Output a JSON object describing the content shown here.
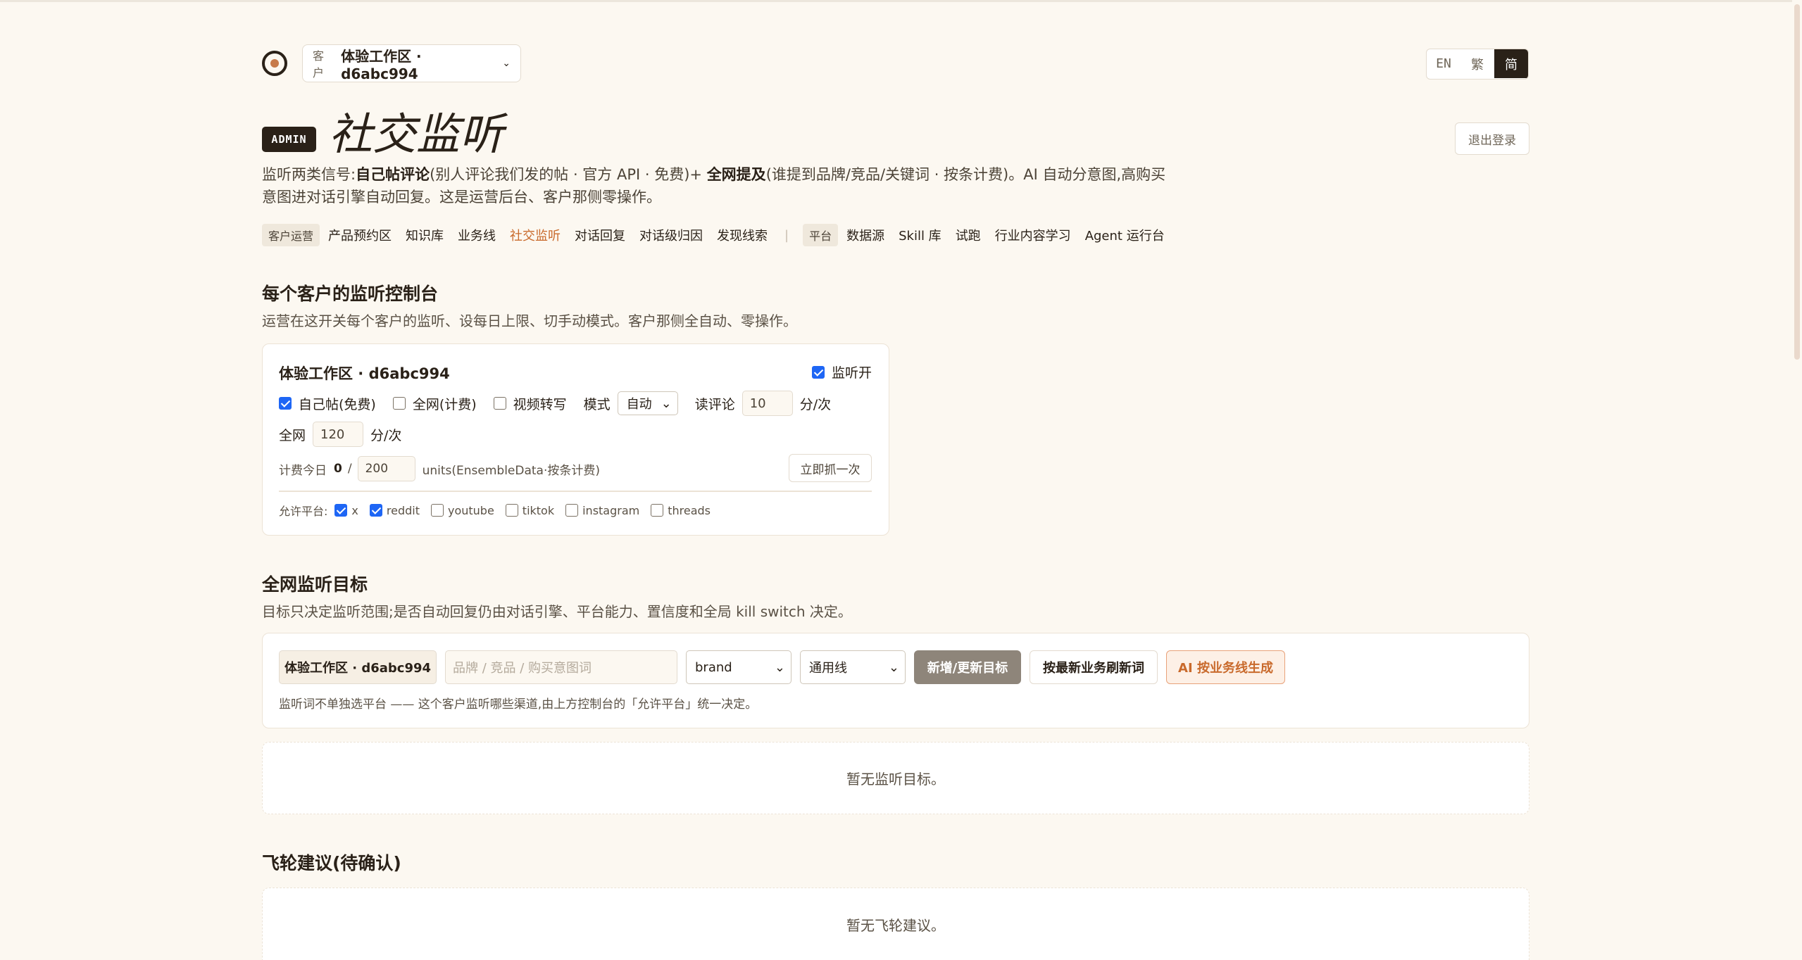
{
  "header": {
    "workspace_prefix": "客户",
    "workspace_name": "体验工作区 · d6abc994",
    "lang": [
      "EN",
      "繁",
      "简"
    ],
    "lang_active": "简",
    "admin_badge": "ADMIN",
    "title": "社交监听",
    "logout": "退出登录"
  },
  "description": {
    "p1": "监听两类信号:",
    "b1": "自己帖评论",
    "p2": "(别人评论我们发的帖 · 官方 API · 免费)+ ",
    "b2": "全网提及",
    "p3": "(谁提到品牌/竞品/关键词 · 按条计费)。AI 自动分意图,高购买意图进对话引擎自动回复。这是运营后台、客户那侧零操作。"
  },
  "nav": {
    "group1_label": "客户运营",
    "group1_items": [
      "产品预约区",
      "知识库",
      "业务线",
      "社交监听",
      "对话回复",
      "对话级归因",
      "发现线索"
    ],
    "active": "社交监听",
    "separator": "|",
    "group2_label": "平台",
    "group2_items": [
      "数据源",
      "Skill 库",
      "试跑",
      "行业内容学习",
      "Agent 运行台"
    ]
  },
  "console": {
    "title": "每个客户的监听控制台",
    "desc": "运营在这开关每个客户的监听、设每日上限、切手动模式。客户那侧全自动、零操作。",
    "card": {
      "name": "体验工作区 · d6abc994",
      "listen_on_label": "监听开",
      "listen_on": true,
      "own_posts_label": "自己帖(免费)",
      "own_posts": true,
      "web_label": "全网(计费)",
      "web": false,
      "video_label": "视频转写",
      "video": false,
      "mode_label": "模式",
      "mode_value": "自动",
      "read_comments_label": "读评论",
      "read_comments_value": "10",
      "per_unit": "分/次",
      "web_interval_label": "全网",
      "web_interval_value": "120",
      "billing_label": "计费今日",
      "billing_used": "0",
      "billing_slash": "/",
      "billing_limit": "200",
      "billing_units": "units(EnsembleData·按条计费)",
      "fetch_now": "立即抓一次",
      "platforms_label": "允许平台:",
      "platforms": [
        {
          "name": "x",
          "on": true
        },
        {
          "name": "reddit",
          "on": true
        },
        {
          "name": "youtube",
          "on": false
        },
        {
          "name": "tiktok",
          "on": false
        },
        {
          "name": "instagram",
          "on": false
        },
        {
          "name": "threads",
          "on": false
        }
      ]
    }
  },
  "targets": {
    "title": "全网监听目标",
    "desc": "目标只决定监听范围;是否自动回复仍由对话引擎、平台能力、置信度和全局 kill switch 决定。",
    "workspace_chip": "体验工作区 · d6abc994",
    "keyword_placeholder": "品牌 / 竞品 / 购买意图词",
    "type_value": "brand",
    "line_value": "通用线",
    "add_button": "新增/更新目标",
    "refresh_button": "按最新业务刷新词",
    "ai_button": "AI 按业务线生成",
    "note": "监听词不单独选平台 —— 这个客户监听哪些渠道,由上方控制台的「允许平台」统一决定。",
    "empty": "暂无监听目标。"
  },
  "flywheel": {
    "title": "飞轮建议(待确认)",
    "empty": "暂无飞轮建议。"
  },
  "colors": {
    "background": "#fcf8f1",
    "ink": "#2a2118",
    "accent": "#c96a2c",
    "checkbox": "#1e66f5"
  }
}
